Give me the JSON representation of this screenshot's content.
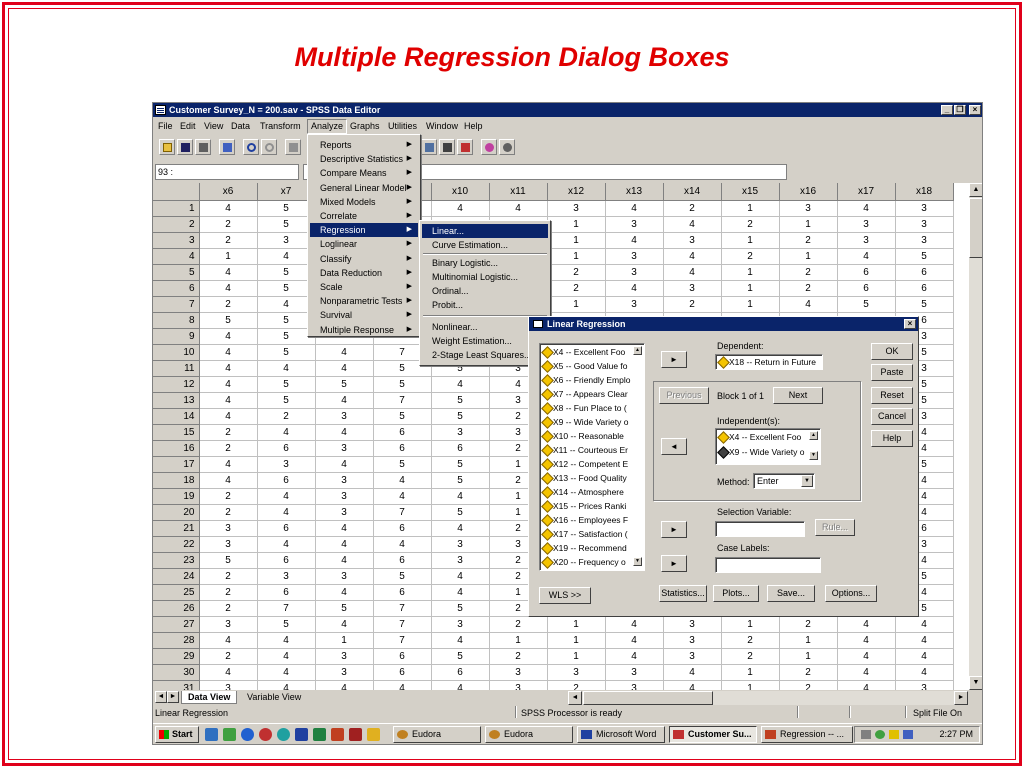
{
  "slide": {
    "title": "Multiple Regression Dialog Boxes"
  },
  "window": {
    "title": "Customer Survey_N = 200.sav - SPSS Data Editor",
    "minimize": "_",
    "maximize": "❐",
    "close": "×"
  },
  "menubar": [
    "File",
    "Edit",
    "View",
    "Data",
    "Transform",
    "Analyze",
    "Graphs",
    "Utilities",
    "Window",
    "Help"
  ],
  "cell_ref": "93 :",
  "grid": {
    "columns": [
      "x6",
      "x7",
      "x8",
      "x9",
      "x10",
      "x11",
      "x12",
      "x13",
      "x14",
      "x15",
      "x16",
      "x17",
      "x18"
    ],
    "rows": [
      [
        "1",
        "4",
        "5",
        "",
        "",
        "4",
        "4",
        "3",
        "4",
        "2",
        "1",
        "3",
        "4",
        "3"
      ],
      [
        "2",
        "2",
        "5",
        "",
        "",
        "",
        "",
        "1",
        "3",
        "4",
        "2",
        "1",
        "3",
        "3"
      ],
      [
        "3",
        "2",
        "3",
        "",
        "",
        "",
        "",
        "1",
        "4",
        "3",
        "1",
        "2",
        "3",
        "3"
      ],
      [
        "4",
        "1",
        "4",
        "",
        "",
        "",
        "",
        "1",
        "3",
        "4",
        "2",
        "1",
        "4",
        "5"
      ],
      [
        "5",
        "4",
        "5",
        "",
        "",
        "",
        "",
        "2",
        "3",
        "4",
        "1",
        "2",
        "6",
        "6"
      ],
      [
        "6",
        "4",
        "5",
        "",
        "",
        "",
        "",
        "2",
        "4",
        "3",
        "1",
        "2",
        "6",
        "6"
      ],
      [
        "7",
        "2",
        "4",
        "",
        "",
        "",
        "",
        "1",
        "3",
        "2",
        "1",
        "4",
        "5",
        "5"
      ],
      [
        "8",
        "5",
        "5",
        "",
        "",
        "",
        "",
        "",
        "",
        "",
        "",
        "",
        "",
        "6"
      ],
      [
        "9",
        "4",
        "5",
        "",
        "",
        "",
        "",
        "",
        "",
        "",
        "",
        "",
        "",
        "3"
      ],
      [
        "10",
        "4",
        "5",
        "4",
        "7",
        "",
        "",
        "",
        "",
        "",
        "",
        "",
        "",
        "5"
      ],
      [
        "11",
        "4",
        "4",
        "4",
        "5",
        "5",
        "3",
        "",
        "",
        "",
        "",
        "",
        "",
        "3"
      ],
      [
        "12",
        "4",
        "5",
        "5",
        "5",
        "4",
        "4",
        "",
        "",
        "",
        "",
        "",
        "",
        "5"
      ],
      [
        "13",
        "4",
        "5",
        "4",
        "7",
        "5",
        "3",
        "",
        "",
        "",
        "",
        "",
        "",
        "5"
      ],
      [
        "14",
        "4",
        "2",
        "3",
        "5",
        "5",
        "2",
        "",
        "",
        "",
        "",
        "",
        "",
        "3"
      ],
      [
        "15",
        "2",
        "4",
        "4",
        "6",
        "3",
        "3",
        "",
        "",
        "",
        "",
        "",
        "",
        "4"
      ],
      [
        "16",
        "2",
        "6",
        "3",
        "6",
        "6",
        "2",
        "",
        "",
        "",
        "",
        "",
        "",
        "4"
      ],
      [
        "17",
        "4",
        "3",
        "4",
        "5",
        "5",
        "1",
        "",
        "",
        "",
        "",
        "",
        "",
        "5"
      ],
      [
        "18",
        "4",
        "6",
        "3",
        "4",
        "5",
        "2",
        "",
        "",
        "",
        "",
        "",
        "",
        "4"
      ],
      [
        "19",
        "2",
        "4",
        "3",
        "4",
        "4",
        "1",
        "",
        "",
        "",
        "",
        "",
        "",
        "4"
      ],
      [
        "20",
        "2",
        "4",
        "3",
        "7",
        "5",
        "1",
        "",
        "",
        "",
        "",
        "",
        "",
        "4"
      ],
      [
        "21",
        "3",
        "6",
        "4",
        "6",
        "4",
        "2",
        "",
        "",
        "",
        "",
        "",
        "",
        "6"
      ],
      [
        "22",
        "3",
        "4",
        "4",
        "4",
        "3",
        "3",
        "",
        "",
        "",
        "",
        "",
        "",
        "3"
      ],
      [
        "23",
        "5",
        "6",
        "4",
        "6",
        "3",
        "2",
        "",
        "",
        "",
        "",
        "",
        "",
        "4"
      ],
      [
        "24",
        "2",
        "3",
        "3",
        "5",
        "4",
        "2",
        "",
        "",
        "",
        "",
        "",
        "",
        "5"
      ],
      [
        "25",
        "2",
        "6",
        "4",
        "6",
        "4",
        "1",
        "",
        "",
        "",
        "",
        "",
        "",
        "4"
      ],
      [
        "26",
        "2",
        "7",
        "5",
        "7",
        "5",
        "2",
        "",
        "",
        "",
        "",
        "",
        "",
        "5"
      ],
      [
        "27",
        "3",
        "5",
        "4",
        "7",
        "3",
        "2",
        "1",
        "4",
        "3",
        "1",
        "2",
        "4",
        "4"
      ],
      [
        "28",
        "4",
        "4",
        "1",
        "7",
        "4",
        "1",
        "1",
        "4",
        "3",
        "2",
        "1",
        "4",
        "4"
      ],
      [
        "29",
        "2",
        "4",
        "3",
        "6",
        "5",
        "2",
        "1",
        "4",
        "3",
        "2",
        "1",
        "4",
        "4"
      ],
      [
        "30",
        "4",
        "4",
        "3",
        "6",
        "6",
        "3",
        "3",
        "3",
        "4",
        "1",
        "2",
        "4",
        "4"
      ],
      [
        "31",
        "3",
        "4",
        "4",
        "4",
        "4",
        "3",
        "2",
        "3",
        "4",
        "1",
        "2",
        "4",
        "3"
      ]
    ]
  },
  "tabs": {
    "data_view": "Data View",
    "variable_view": "Variable View"
  },
  "status": {
    "left": "Linear Regression",
    "processor": "SPSS Processor  is ready",
    "right": "Split File On"
  },
  "analyze_menu": [
    "Reports",
    "Descriptive Statistics",
    "Compare Means",
    "General Linear Model",
    "Mixed Models",
    "Correlate",
    "Regression",
    "Loglinear",
    "Classify",
    "Data Reduction",
    "Scale",
    "Nonparametric Tests",
    "Survival",
    "Multiple Response"
  ],
  "regression_menu": [
    "Linear...",
    "Curve Estimation...",
    "Binary Logistic...",
    "Multinomial Logistic...",
    "Ordinal...",
    "Probit...",
    "Nonlinear...",
    "Weight Estimation...",
    "2-Stage Least Squares..."
  ],
  "dialog": {
    "title": "Linear Regression",
    "variables": [
      "X4 -- Excellent Foo",
      "X5 -- Good Value fo",
      "X6 -- Friendly Emplo",
      "X7 -- Appears Clear",
      "X8 -- Fun Place to (",
      "X9 -- Wide Variety o",
      "X10 -- Reasonable",
      "X11 -- Courteous Er",
      "X12 -- Competent E",
      "X13 -- Food Quality",
      "X14 -- Atmosphere",
      "X15 -- Prices Ranki",
      "X16 -- Employees F",
      "X17 -- Satisfaction (",
      "X19 -- Recommend",
      "X20 -- Frequency o"
    ],
    "dependent_label": "Dependent:",
    "dependent_value": "X18 -- Return in Future",
    "previous": "Previous",
    "block": "Block 1 of 1",
    "next": "Next",
    "independent_label": "Independent(s):",
    "independents": [
      "X4 -- Excellent Foo",
      "X9 -- Wide Variety o"
    ],
    "method_label": "Method:",
    "method_value": "Enter",
    "selection_label": "Selection Variable:",
    "rule": "Rule...",
    "case_labels": "Case Labels:",
    "wls": "WLS >>",
    "buttons": {
      "ok": "OK",
      "paste": "Paste",
      "reset": "Reset",
      "cancel": "Cancel",
      "help": "Help"
    },
    "bottom_buttons": {
      "statistics": "Statistics...",
      "plots": "Plots...",
      "save": "Save...",
      "options": "Options..."
    }
  },
  "taskbar": {
    "start": "Start",
    "tasks": [
      "Eudora",
      "Eudora",
      "Microsoft Word",
      "Customer Su...",
      "Regression -- ..."
    ],
    "clock": "2:27 PM"
  }
}
